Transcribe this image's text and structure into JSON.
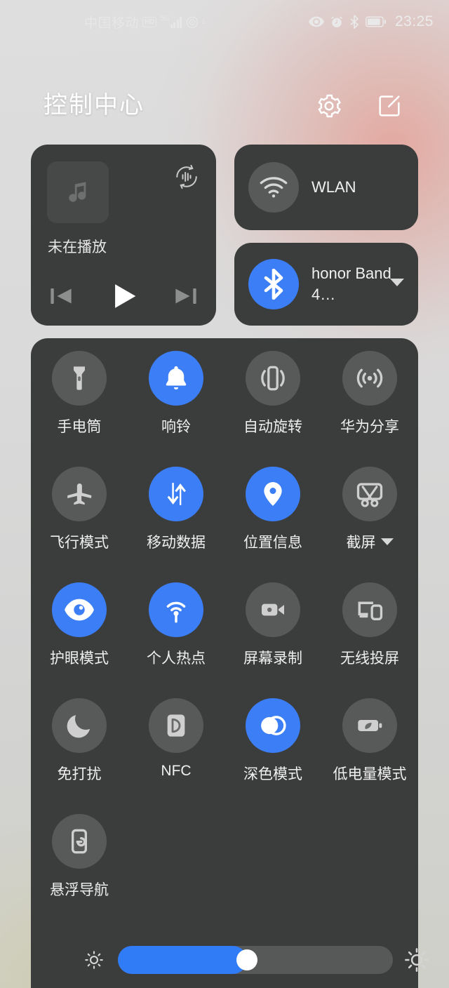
{
  "theme": {
    "accent": "#3c7ef5",
    "panel_bg": "#3b3c3c",
    "circle_off": "#585959",
    "text": "#efefef"
  },
  "status_bar": {
    "carrier": "中国移动",
    "hd_badge": "HD",
    "network_type": "5G",
    "signal_bars": 4,
    "hotspot_count": "1",
    "icons": [
      "eye-comfort-icon",
      "alarm-icon",
      "bluetooth-icon",
      "battery-icon"
    ],
    "time": "23:25"
  },
  "header": {
    "title": "控制中心",
    "settings_icon": "gear-icon",
    "edit_icon": "edit-icon"
  },
  "media_card": {
    "album_art_icon": "music-note-icon",
    "cast_icon": "audio-cast-icon",
    "title": "未在播放",
    "controls": [
      {
        "name": "previous-track-button",
        "icon": "skip-previous-icon"
      },
      {
        "name": "play-button",
        "icon": "play-icon"
      },
      {
        "name": "next-track-button",
        "icon": "skip-next-icon"
      }
    ]
  },
  "connectivity": [
    {
      "name": "wlan-card",
      "icon": "wifi-icon",
      "label": "WLAN",
      "active": false,
      "has_chevron": false
    },
    {
      "name": "bluetooth-card",
      "icon": "bluetooth-icon",
      "label": "honor Band 4…",
      "active": true,
      "has_chevron": true
    }
  ],
  "toggles": [
    {
      "name": "toggle-flashlight",
      "icon": "flashlight-icon",
      "label": "手电筒",
      "active": false,
      "chevron": false
    },
    {
      "name": "toggle-ring",
      "icon": "bell-icon",
      "label": "响铃",
      "active": true,
      "chevron": false
    },
    {
      "name": "toggle-auto-rotate",
      "icon": "auto-rotate-icon",
      "label": "自动旋转",
      "active": false,
      "chevron": false
    },
    {
      "name": "toggle-huawei-share",
      "icon": "huawei-share-icon",
      "label": "华为分享",
      "active": false,
      "chevron": false
    },
    {
      "name": "toggle-airplane-mode",
      "icon": "airplane-icon",
      "label": "飞行模式",
      "active": false,
      "chevron": false
    },
    {
      "name": "toggle-mobile-data",
      "icon": "mobile-data-icon",
      "label": "移动数据",
      "active": true,
      "chevron": false
    },
    {
      "name": "toggle-location",
      "icon": "location-pin-icon",
      "label": "位置信息",
      "active": true,
      "chevron": false
    },
    {
      "name": "toggle-screenshot",
      "icon": "screenshot-icon",
      "label": "截屏",
      "active": false,
      "chevron": true
    },
    {
      "name": "toggle-eye-comfort",
      "icon": "eye-icon",
      "label": "护眼模式",
      "active": true,
      "chevron": false
    },
    {
      "name": "toggle-hotspot",
      "icon": "hotspot-icon",
      "label": "个人热点",
      "active": true,
      "chevron": false
    },
    {
      "name": "toggle-screen-record",
      "icon": "video-camera-icon",
      "label": "屏幕录制",
      "active": false,
      "chevron": false
    },
    {
      "name": "toggle-wireless-cast",
      "icon": "cast-screen-icon",
      "label": "无线投屏",
      "active": false,
      "chevron": false
    },
    {
      "name": "toggle-do-not-disturb",
      "icon": "moon-icon",
      "label": "免打扰",
      "active": false,
      "chevron": false
    },
    {
      "name": "toggle-nfc",
      "icon": "nfc-icon",
      "label": "NFC",
      "active": false,
      "chevron": false
    },
    {
      "name": "toggle-dark-mode",
      "icon": "dark-mode-icon",
      "label": "深色模式",
      "active": true,
      "chevron": false
    },
    {
      "name": "toggle-battery-saver",
      "icon": "battery-leaf-icon",
      "label": "低电量模式",
      "active": false,
      "chevron": false
    },
    {
      "name": "toggle-floating-nav",
      "icon": "floating-nav-icon",
      "label": "悬浮导航",
      "active": false,
      "chevron": false
    }
  ],
  "brightness": {
    "low_icon": "brightness-low-icon",
    "high_icon": "brightness-high-icon",
    "value_percent": 47
  }
}
